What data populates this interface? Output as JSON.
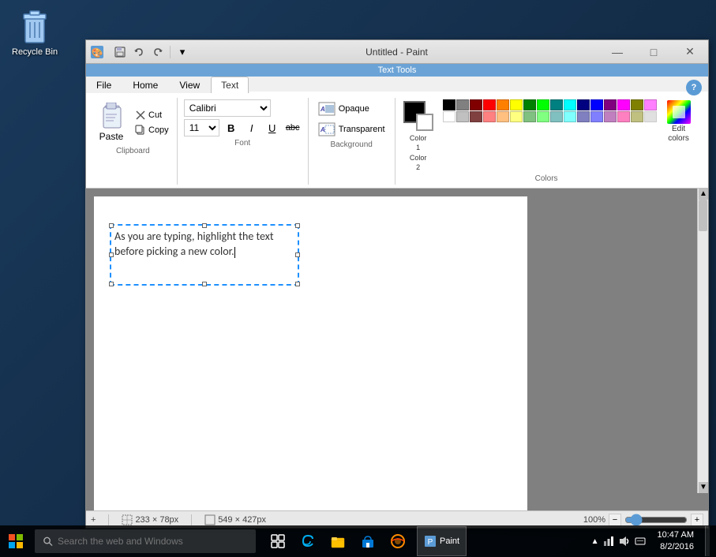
{
  "window": {
    "title": "Untitled - Paint",
    "app_icon": "🎨"
  },
  "titlebar": {
    "minimize_label": "—",
    "maximize_label": "□",
    "close_label": "✕"
  },
  "qat": {
    "save_tooltip": "Save",
    "undo_tooltip": "Undo",
    "redo_tooltip": "Redo",
    "dropdown_tooltip": "Customize"
  },
  "ribbon": {
    "text_tools_label": "Text Tools",
    "tabs": [
      {
        "label": "File",
        "active": false
      },
      {
        "label": "Home",
        "active": false
      },
      {
        "label": "View",
        "active": false
      },
      {
        "label": "Text",
        "active": true
      }
    ],
    "clipboard": {
      "paste_label": "Paste",
      "cut_label": "Cut",
      "copy_label": "Copy",
      "section_label": "Clipboard"
    },
    "font": {
      "name": "Calibri",
      "size": "11",
      "bold_label": "B",
      "italic_label": "I",
      "underline_label": "U",
      "strikethrough_label": "abc",
      "section_label": "Font"
    },
    "background": {
      "opaque_label": "Opaque",
      "transparent_label": "Transparent",
      "section_label": "Background"
    },
    "colors": {
      "color1_label": "Color",
      "color1_num": "1",
      "color2_label": "Color",
      "color2_num": "2",
      "edit_colors_label": "Edit\ncolors",
      "section_label": "Colors",
      "palette_row1": [
        "#000000",
        "#808080",
        "#800000",
        "#ff0000",
        "#ff8000",
        "#ffff00",
        "#008000",
        "#00ff00",
        "#008080",
        "#00ffff",
        "#000080",
        "#0000ff",
        "#800080",
        "#ff00ff",
        "#808040",
        "#ff80ff"
      ],
      "palette_row2": [
        "#ffffff",
        "#c0c0c0",
        "#804040",
        "#ff8080",
        "#ffc080",
        "#ffff80",
        "#80c080",
        "#80ff80",
        "#80c0c0",
        "#80ffff",
        "#8080c0",
        "#8080ff",
        "#c080c0",
        "#ff80ff",
        "#c0c080",
        "#e0e0e0"
      ]
    }
  },
  "canvas": {
    "text_content": "As you are typing, highlight the text\nbefore picking a new color.",
    "canvas_size": "549 × 427px",
    "selection_size": "233 × 78px"
  },
  "statusbar": {
    "add_icon": "+",
    "size_icon": "⊞",
    "selection_size": "233 × 78px",
    "canvas_size": "549 × 427px",
    "zoom_level": "100%"
  },
  "taskbar": {
    "start_label": "⊞",
    "search_placeholder": "Search the web and Windows",
    "task_view_icon": "⧉",
    "edge_label": "e",
    "explorer_label": "📁",
    "store_label": "🛍",
    "ie_label": "🌐",
    "clock": "10:47 AM",
    "date": "8/2/2016"
  },
  "desktop": {
    "recycle_bin_label": "Recycle Bin"
  }
}
